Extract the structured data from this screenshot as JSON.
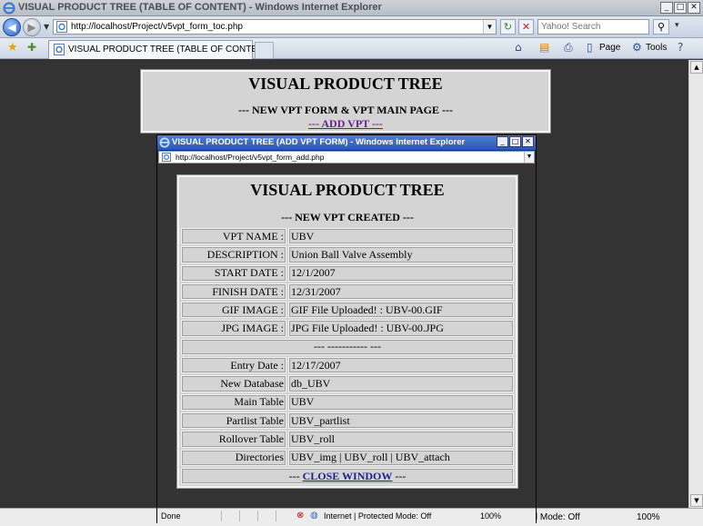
{
  "window": {
    "title": "VISUAL PRODUCT TREE (TABLE OF CONTENT) - Windows Internet Explorer",
    "url": "http://localhost/Project/v5vpt_form_toc.php",
    "search_placeholder": "Yahoo! Search",
    "tab_label": "VISUAL PRODUCT TREE (TABLE OF CONTENT)",
    "commands": {
      "page": "Page",
      "tools": "Tools"
    },
    "status": {
      "zone": "Internet | Protected Mode: Off",
      "zone_partial": "ed Mode: Off",
      "zoom": "100%"
    }
  },
  "main": {
    "title": "VISUAL PRODUCT TREE",
    "subtitle": "--- NEW VPT FORM & VPT MAIN PAGE ---",
    "add_link": "--- ADD VPT ---"
  },
  "popup": {
    "title": "VISUAL PRODUCT TREE (ADD VPT FORM) - Windows Internet Explorer",
    "url": "http://localhost/Project/v5vpt_form_add.php",
    "status": {
      "done": "Done",
      "zone": "Internet | Protected Mode: Off",
      "zoom": "100%"
    },
    "heading": "VISUAL PRODUCT TREE",
    "subheading": "--- NEW VPT CREATED ---",
    "fields": [
      {
        "label": "VPT NAME :",
        "value": "UBV"
      },
      {
        "label": "DESCRIPTION :",
        "value": "Union Ball Valve Assembly"
      },
      {
        "label": "START DATE :",
        "value": "12/1/2007"
      },
      {
        "label": "FINISH DATE :",
        "value": "12/31/2007"
      },
      {
        "label": "GIF IMAGE :",
        "value": "GIF File Uploaded! : UBV-00.GIF"
      },
      {
        "label": "JPG IMAGE :",
        "value": "JPG File Uploaded! : UBV-00.JPG"
      }
    ],
    "separator": "--- ----------- ---",
    "db_fields": [
      {
        "label": "Entry Date :",
        "value": "12/17/2007"
      },
      {
        "label": "New Database",
        "value": "db_UBV"
      },
      {
        "label": "Main Table",
        "value": "UBV"
      },
      {
        "label": "Partlist Table",
        "value": "UBV_partlist"
      },
      {
        "label": "Rollover Table",
        "value": "UBV_roll"
      },
      {
        "label": "Directories",
        "value": "UBV_img | UBV_roll | UBV_attach"
      }
    ],
    "close_prefix": "---",
    "close_link": "CLOSE WINDOW",
    "close_suffix": "---"
  },
  "colors": {
    "titlebar_active": "#2a57b5",
    "visited_link": "#6b1f8c",
    "link": "#1f1f8f",
    "panel_bg": "#d4d4d4",
    "page_bg": "#333333"
  },
  "icons": [
    "ie-logo-icon",
    "back-icon",
    "forward-icon",
    "page-icon",
    "refresh-icon",
    "stop-icon",
    "search-icon",
    "favorites-star-icon",
    "add-favorites-icon",
    "home-icon",
    "feeds-icon",
    "print-icon",
    "page-menu-icon",
    "tools-icon",
    "help-icon",
    "globe-icon",
    "popup-blocked-icon",
    "minimize-icon",
    "maximize-icon",
    "close-icon"
  ]
}
